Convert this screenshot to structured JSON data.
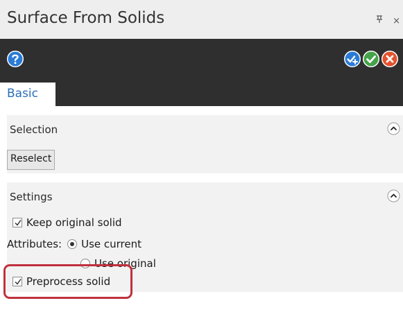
{
  "window": {
    "title": "Surface From Solids",
    "pin_icon": "pin-icon",
    "close_glyph": "×"
  },
  "toolbar": {
    "help_icon": "help-icon",
    "apply_icon": "apply-icon",
    "ok_icon": "ok-icon",
    "cancel_icon": "cancel-icon",
    "colors": {
      "background": "#2f2f2f",
      "help": "#2a7bd6",
      "apply": "#2a7bd6",
      "ok": "#45a24a",
      "cancel": "#e2532f"
    }
  },
  "tabs": [
    {
      "label": "Basic",
      "active": true
    }
  ],
  "sections": {
    "selection": {
      "title": "Selection",
      "reselect_label": "Reselect"
    },
    "settings": {
      "title": "Settings",
      "keep_original_label": "Keep original solid",
      "keep_original_checked": true,
      "attributes_label": "Attributes:",
      "attributes_options": [
        "Use current",
        "Use original"
      ],
      "attributes_selected": "Use current",
      "preprocess_label": "Preprocess solid",
      "preprocess_checked": true
    }
  },
  "colors": {
    "accent": "#2a6eb8",
    "highlight": "#c0303c"
  }
}
